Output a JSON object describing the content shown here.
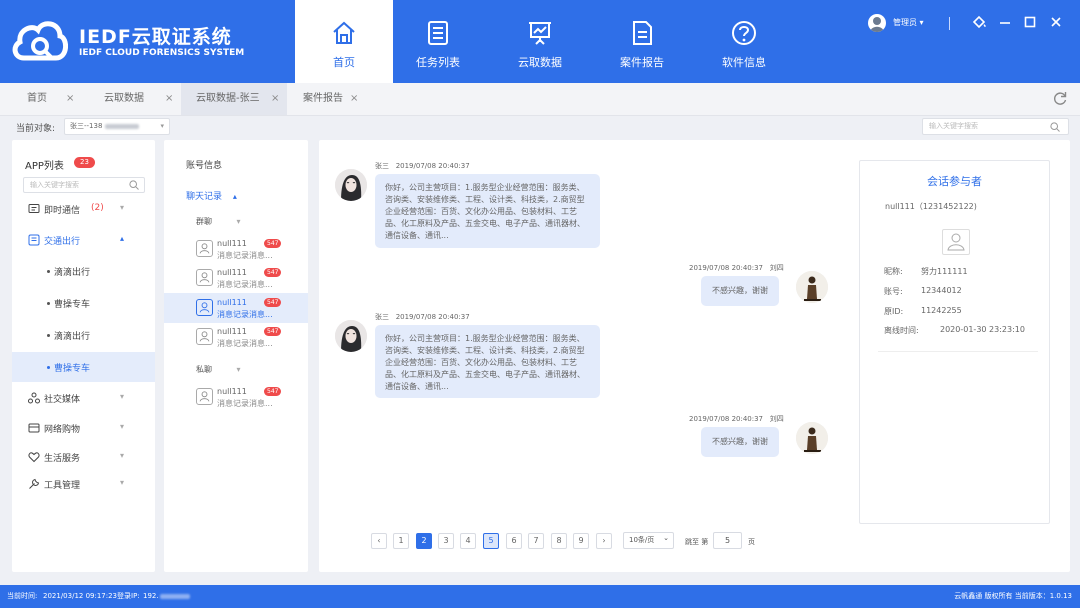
{
  "app": {
    "title": "IEDF云取证系统",
    "subtitle": "IEDF CLOUD FORENSICS SYSTEM"
  },
  "nav": [
    {
      "label": "首页",
      "icon": "home-icon",
      "active": true
    },
    {
      "label": "任务列表",
      "icon": "task-list-icon"
    },
    {
      "label": "云取数据",
      "icon": "presentation-chart-icon"
    },
    {
      "label": "案件报告",
      "icon": "document-icon"
    },
    {
      "label": "软件信息",
      "icon": "help-icon"
    }
  ],
  "user": {
    "name": "管理员 ▾"
  },
  "tabs": [
    {
      "label": "首页",
      "close": "×"
    },
    {
      "label": "云取数据",
      "close": "×"
    },
    {
      "label": "云取数据-张三",
      "close": "×",
      "active": true
    },
    {
      "label": "案件报告",
      "close": "×"
    }
  ],
  "target": {
    "label": "当前对象:",
    "value": "张三--138",
    "chevron": "▾"
  },
  "top_search": {
    "placeholder": "输入关键字搜索"
  },
  "app_list": {
    "title": "APP列表",
    "count": "23",
    "search_placeholder": "输入关键字搜索",
    "items": [
      {
        "label": "即时通信",
        "count": "(2)",
        "icon": "chat-icon",
        "chevron": "▾"
      },
      {
        "label": "交通出行",
        "icon": "transport-icon",
        "chevron": "▴",
        "expanded": true
      },
      {
        "label": "社交媒体",
        "icon": "social-icon",
        "chevron": "▾"
      },
      {
        "label": "网络购物",
        "icon": "shopping-icon",
        "chevron": "▾"
      },
      {
        "label": "生活服务",
        "icon": "heart-icon",
        "chevron": "▾"
      },
      {
        "label": "工具管理",
        "icon": "wrench-icon",
        "chevron": "▾"
      }
    ],
    "sub_items": [
      "滴滴出行",
      "曹操专车",
      "滴滴出行",
      "曹操专车"
    ]
  },
  "account": {
    "info_label": "账号信息",
    "chat_records_label": "聊天记录",
    "chat_records_chevron": "▴",
    "group_label": "群聊",
    "private_label": "私聊",
    "group_chevron": "▾",
    "contacts": [
      {
        "name": "null111",
        "msg": "消息记录消息...",
        "badge": "547"
      },
      {
        "name": "null111",
        "msg": "消息记录消息...",
        "badge": "547"
      },
      {
        "name": "null111",
        "msg": "消息记录消息...",
        "badge": "547",
        "active": true
      },
      {
        "name": "null111",
        "msg": "消息记录消息...",
        "badge": "547"
      },
      {
        "name": "null111",
        "msg": "消息记录消息...",
        "badge": "547"
      }
    ]
  },
  "messages": [
    {
      "sender": "张三",
      "time": "2019/07/08 20:40:37",
      "side": "left",
      "text": "你好，公司主营项目：1.服务型企业经营范围：服务类、咨询类、安装维修类、工程、设计类、科技类，2.商贸型企业经营范围：百货、文化办公用品、包装材料、工艺品、化工原料及产品、五金交电、电子产品、通讯器材、通信设备、通讯..."
    },
    {
      "sender": "刘四",
      "time": "2019/07/08 20:40:37",
      "side": "right",
      "text": "不感兴趣，谢谢"
    },
    {
      "sender": "张三",
      "time": "2019/07/08 20:40:37",
      "side": "left",
      "text": "你好，公司主营项目：1.服务型企业经营范围：服务类、咨询类、安装维修类、工程、设计类、科技类，2.商贸型企业经营范围：百货、文化办公用品、包装材料、工艺品、化工原料及产品、五金交电、电子产品、通讯器材、通信设备、通讯..."
    },
    {
      "sender": "刘四",
      "time": "2019/07/08 20:40:37",
      "side": "right",
      "text": "不感兴趣，谢谢"
    }
  ],
  "participant": {
    "title": "会话参与者",
    "account": "null111（1231452122)",
    "fields": [
      {
        "label": "昵称:",
        "value": "努力111111"
      },
      {
        "label": "账号:",
        "value": "12344012"
      },
      {
        "label": "原ID:",
        "value": "11242255"
      },
      {
        "label": "离线时间:",
        "value": "2020-01-30  23:23:10"
      }
    ]
  },
  "pagination": {
    "prev": "‹",
    "next": "›",
    "pages": [
      "1",
      "2",
      "3",
      "4",
      "5",
      "6",
      "7",
      "8",
      "9"
    ],
    "current": "2",
    "highlighted": "5",
    "per_page": "10条/页",
    "per_page_chevron": "⌄",
    "jump_label": "跳至 第",
    "jump_value": "5",
    "page_suffix": "页"
  },
  "status": {
    "time_label": "当前时间:",
    "time_value": "2021/03/12 09:17:23",
    "ip_label": "登录IP:",
    "ip_value": "192.",
    "right": "云帆鑫通 版权所有 当前版本：1.0.13"
  },
  "colors": {
    "primary": "#2f6fe8",
    "badge": "#ef4b4b",
    "bubble": "#e3ebfb"
  }
}
